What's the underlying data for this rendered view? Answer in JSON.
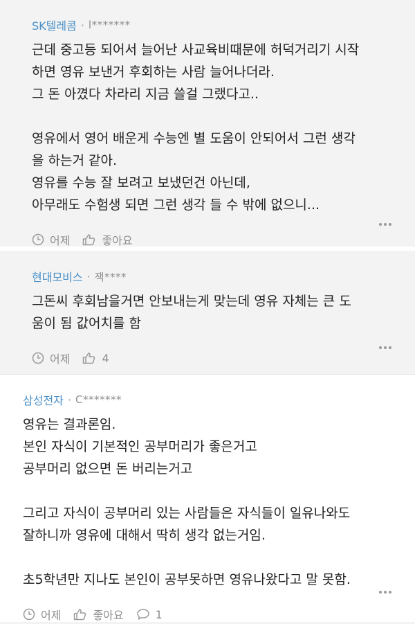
{
  "comments": [
    {
      "company": "SK텔레콤",
      "user": "l*******",
      "lines": [
        "근데 중고등 되어서 늘어난 사교육비때문에 허덕거리기 시작",
        "하면 영유 보낸거 후회하는 사람 늘어나더라.",
        "그 돈 아꼈다 차라리 지금 쓸걸 그랬다고..",
        "",
        "영유에서 영어 배운게 수능엔 별 도움이 안되어서 그런 생각",
        "을 하는거 같아.",
        "영유를 수능 잘 보려고 보냈던건 아닌데,",
        "아무래도 수험생 되면 그런 생각 들 수 밖에 없으니..."
      ],
      "time": "어제",
      "like_label": "좋아요"
    },
    {
      "company": "현대모비스",
      "user": "잭****",
      "lines": [
        "그돈씨 후회남을거면 안보내는게 맞는데 영유 자체는 큰 도",
        "움이 됨 값어치를 함"
      ],
      "time": "어제",
      "like_label": "4"
    },
    {
      "company": "삼성전자",
      "user": "C*******",
      "lines": [
        "영유는 결과론임.",
        "본인 자식이 기본적인 공부머리가 좋은거고",
        "공부머리 없으면 돈 버리는거고",
        "",
        "그리고 자식이 공부머리 있는 사람들은 자식들이 일유나와도",
        "잘하니까 영유에 대해서 딱히 생각 없는거임.",
        "",
        "초5학년만 지나도 본인이 공부못하면 영유나왔다고 말 못함."
      ],
      "time": "어제",
      "like_label": "좋아요",
      "reply_count": "1"
    }
  ]
}
